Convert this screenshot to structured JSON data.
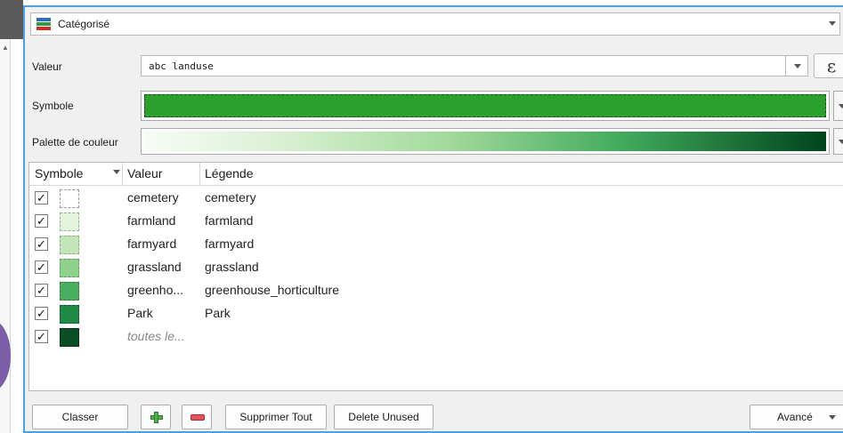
{
  "renderer": {
    "label": "Catégorisé"
  },
  "fields": {
    "valeur_label": "Valeur",
    "valeur_value": "abc landuse",
    "expression_glyph": "ε",
    "symbole_label": "Symbole",
    "palette_label": "Palette de couleur"
  },
  "colors": {
    "accent_border": "#4aa3df",
    "symbol_fill": "#2ca02c",
    "ramp": [
      "#f7fcf5",
      "#d9f0d3",
      "#a1d99b",
      "#41ab5d",
      "#00441b"
    ]
  },
  "table": {
    "headers": {
      "symbol": "Symbole",
      "value": "Valeur",
      "legend": "Légende"
    },
    "rows": [
      {
        "checked": true,
        "check_glyph": "✓",
        "color": "#ffffff",
        "value": "cemetery",
        "legend": "cemetery"
      },
      {
        "checked": true,
        "check_glyph": "✓",
        "color": "#e3f4dc",
        "value": "farmland",
        "legend": "farmland"
      },
      {
        "checked": true,
        "check_glyph": "✓",
        "color": "#c2e6b8",
        "value": "farmyard",
        "legend": "farmyard"
      },
      {
        "checked": true,
        "check_glyph": "✓",
        "color": "#8fd08a",
        "value": "grassland",
        "legend": "grassland"
      },
      {
        "checked": true,
        "check_glyph": "✓",
        "color": "#4aae61",
        "value": "greenho...",
        "legend": "greenhouse_horticulture"
      },
      {
        "checked": true,
        "check_glyph": "✓",
        "color": "#1e8a46",
        "value": "Park",
        "legend": "Park"
      },
      {
        "checked": true,
        "check_glyph": "✓",
        "color": "#0b4d24",
        "value": "toutes le...",
        "legend": ""
      }
    ]
  },
  "buttons": {
    "classer": "Classer",
    "add_icon": "plus-icon",
    "remove_icon": "minus-icon",
    "supprimer_tout": "Supprimer Tout",
    "delete_unused": "Delete Unused",
    "avance": "Avancé"
  }
}
